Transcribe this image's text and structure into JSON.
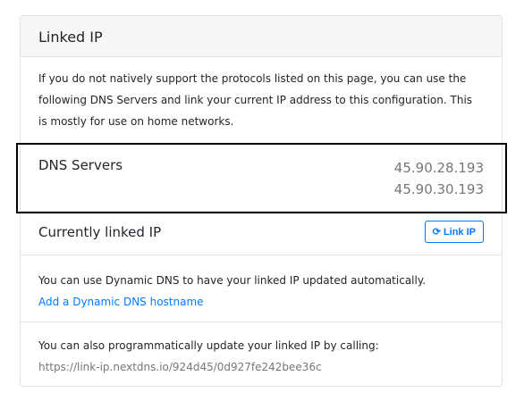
{
  "header": {
    "title": "Linked IP"
  },
  "intro": "If you do not natively support the protocols listed on this page, you can use the following DNS Servers and link your current IP address to this configuration. This is mostly for use on home networks.",
  "dns": {
    "label": "DNS Servers",
    "servers": [
      "45.90.28.193",
      "45.90.30.193"
    ]
  },
  "linked": {
    "label": "Currently linked IP",
    "button": "Link IP",
    "button_icon": "refresh-icon"
  },
  "dynamic": {
    "text": "You can use Dynamic DNS to have your linked IP updated automatically.",
    "link": "Add a Dynamic DNS hostname"
  },
  "api": {
    "text": "You can also programmatically update your linked IP by calling:",
    "url": "https://link-ip.nextdns.io/924d45/0d927fe242bee36c"
  }
}
